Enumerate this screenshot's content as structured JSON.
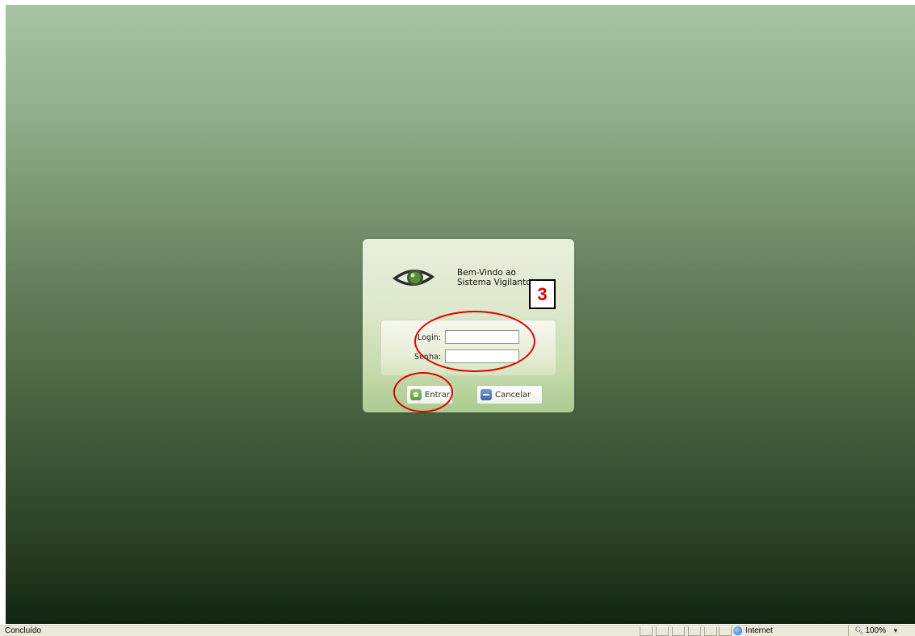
{
  "dialog": {
    "welcome_line1": "Bem-Vindo ao",
    "welcome_line2": "Sistema Vigilanto",
    "login_label": "Login:",
    "senha_label": "Senha:",
    "login_value": "",
    "senha_value": "",
    "entrar_label": "Entrar",
    "cancelar_label": "Cancelar",
    "logo_icon": "eye-icon"
  },
  "annotation": {
    "step_number": "3",
    "color": "#e00000"
  },
  "status_bar": {
    "status_text": "Concluído",
    "zone_text": "Internet",
    "zoom_text": "100%"
  },
  "colors": {
    "background_top": "#a7c4a3",
    "background_bottom": "#112610",
    "dialog_bg": "#dde8cc"
  }
}
